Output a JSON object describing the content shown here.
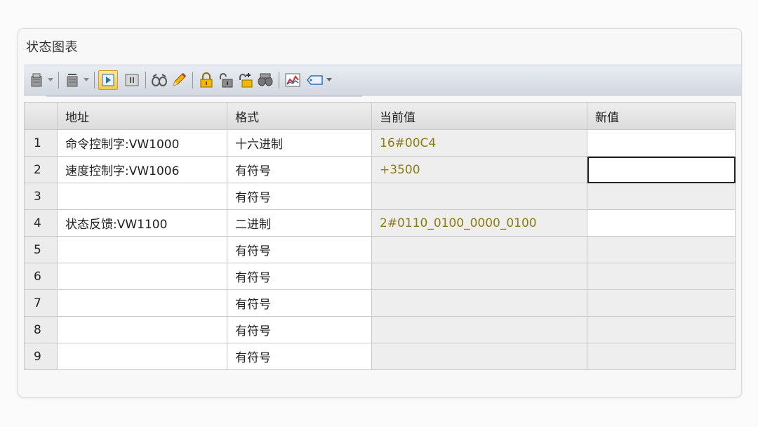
{
  "window": {
    "title": "状态图表"
  },
  "toolbar": {
    "buttons": [
      {
        "name": "insert-row-icon",
        "has_dropdown": true
      },
      {
        "name": "delete-row-icon",
        "has_dropdown": true
      },
      {
        "name": "single-read-icon",
        "active": true
      },
      {
        "name": "stop-trend-icon"
      },
      {
        "name": "glasses-icon"
      },
      {
        "name": "pencil-icon"
      },
      {
        "name": "force-lock-icon"
      },
      {
        "name": "unforce-icon"
      },
      {
        "name": "unforce-all-icon"
      },
      {
        "name": "read-forced-icon"
      },
      {
        "name": "trend-view-icon"
      },
      {
        "name": "tag-icon",
        "has_dropdown": true
      }
    ]
  },
  "table": {
    "columns": [
      "地址",
      "格式",
      "当前值",
      "新值"
    ],
    "rows": [
      {
        "num": "1",
        "address": "命令控制字:VW1000",
        "format": "十六进制",
        "current": "16#00C4",
        "new": ""
      },
      {
        "num": "2",
        "address": "速度控制字:VW1006",
        "format": "有符号",
        "current": "+3500",
        "new": ""
      },
      {
        "num": "3",
        "address": "",
        "format": "有符号",
        "current": "",
        "new": ""
      },
      {
        "num": "4",
        "address": "状态反馈:VW1100",
        "format": "二进制",
        "current": "2#0110_0100_0000_0100",
        "new": ""
      },
      {
        "num": "5",
        "address": "",
        "format": "有符号",
        "current": "",
        "new": ""
      },
      {
        "num": "6",
        "address": "",
        "format": "有符号",
        "current": "",
        "new": ""
      },
      {
        "num": "7",
        "address": "",
        "format": "有符号",
        "current": "",
        "new": ""
      },
      {
        "num": "8",
        "address": "",
        "format": "有符号",
        "current": "",
        "new": ""
      },
      {
        "num": "9",
        "address": "",
        "format": "有符号",
        "current": "",
        "new": ""
      }
    ]
  },
  "colors": {
    "value_text": "#8a7d13",
    "active_button": "#f7c84a"
  }
}
